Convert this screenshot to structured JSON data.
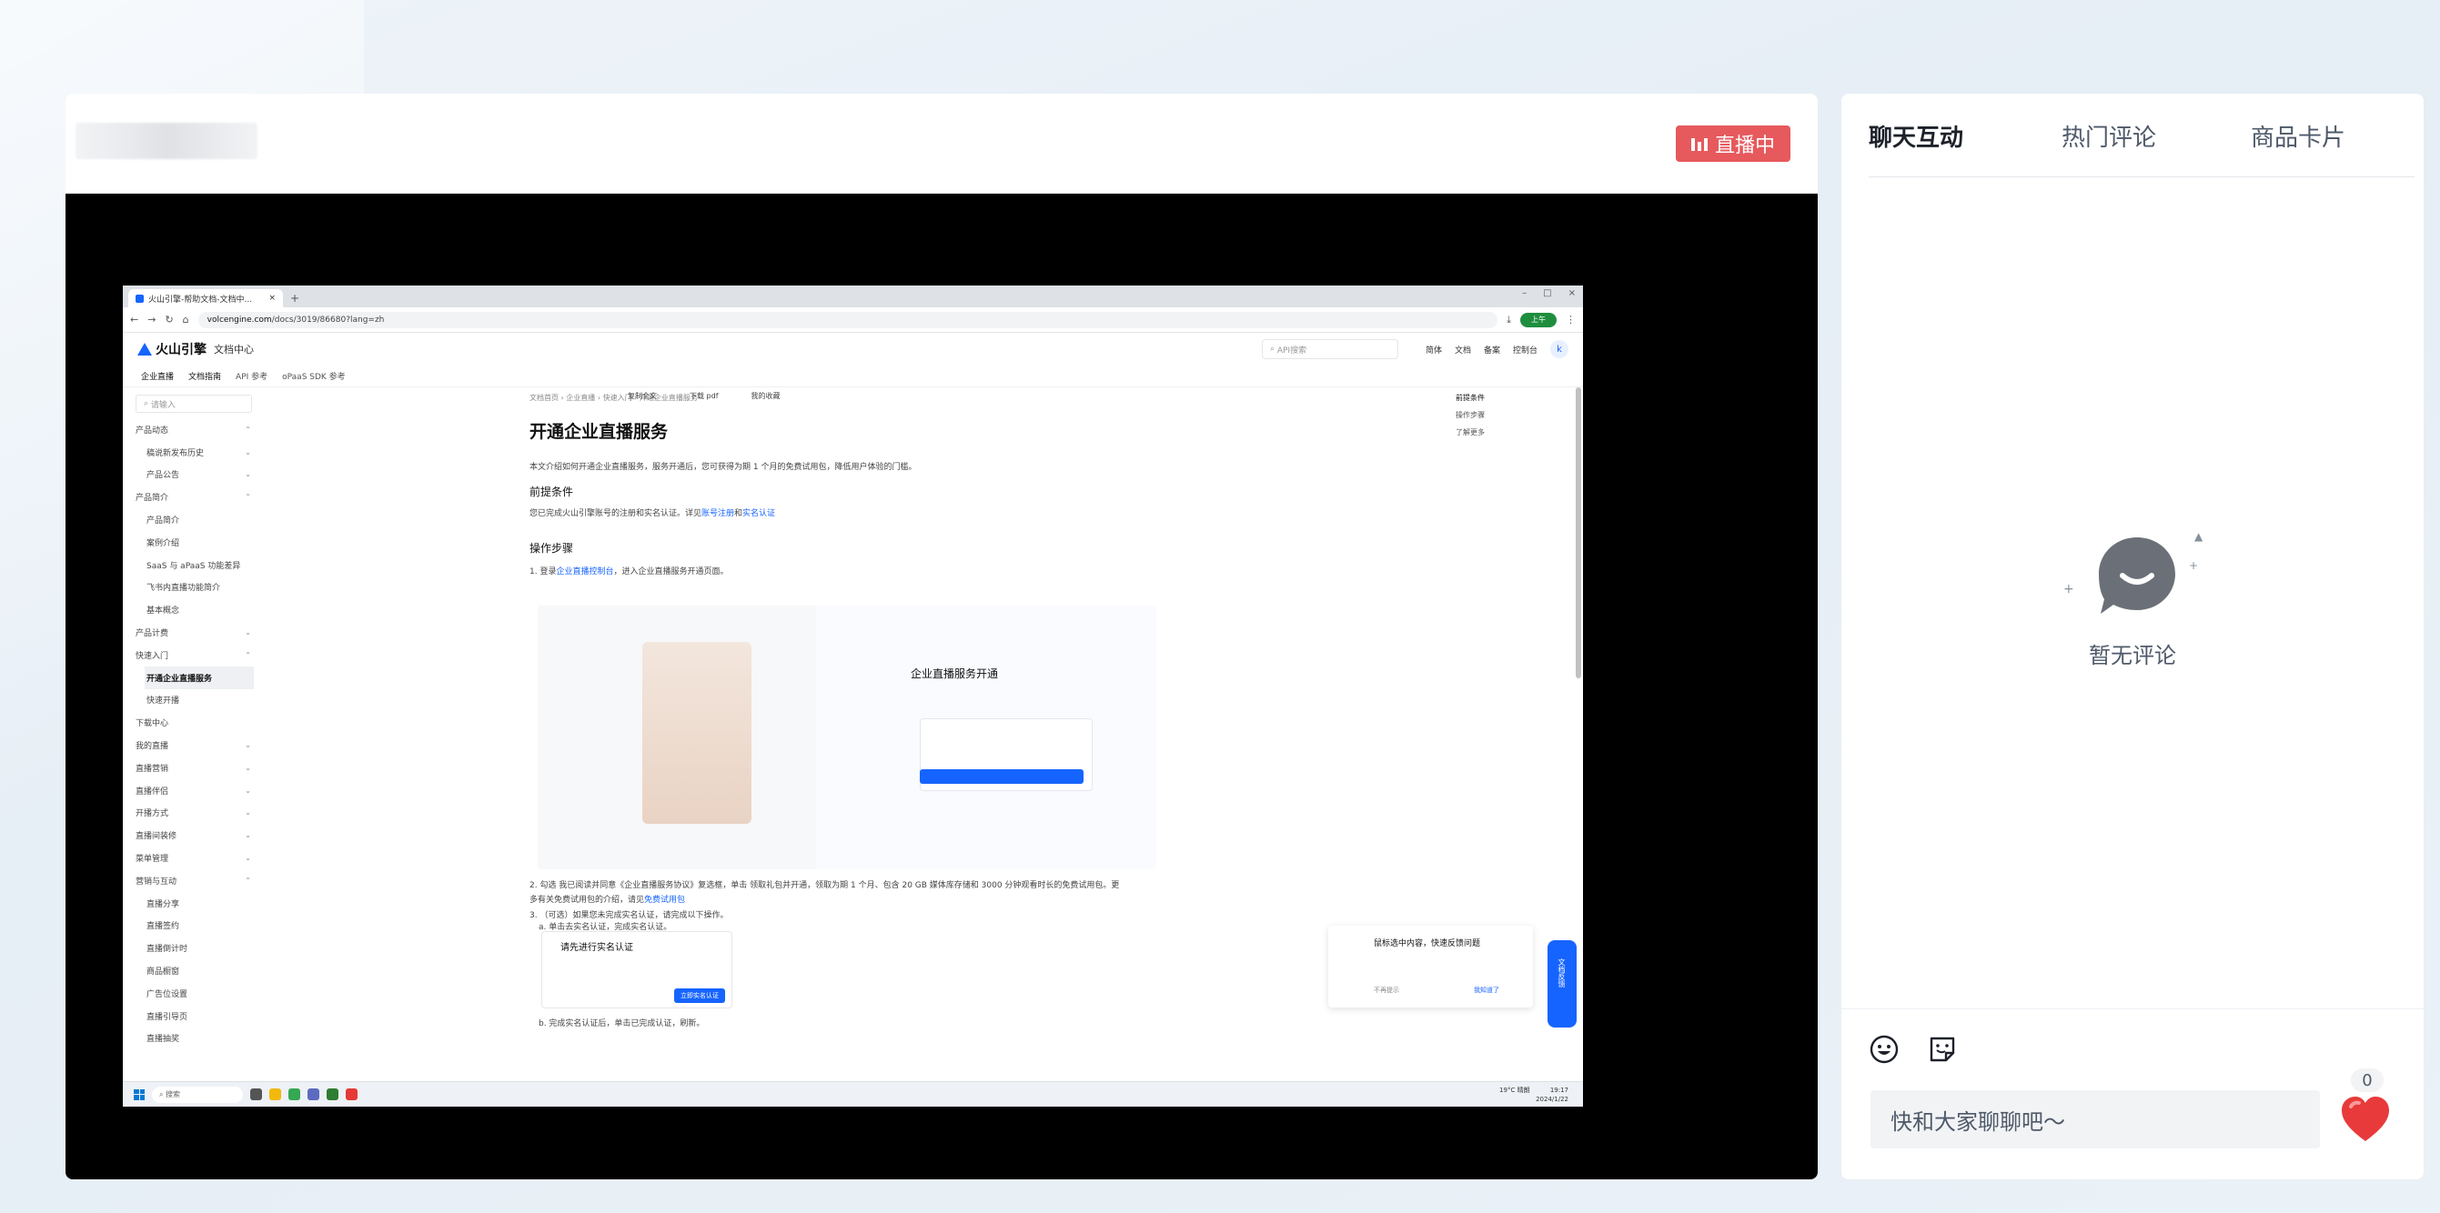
{
  "stream": {
    "live_label": "直播中"
  },
  "screen": {
    "tab_title": "火山引擎-帮助文档-文档中...",
    "url_host": "volcengine.com",
    "url_path": "/docs/3019/86680?lang=zh",
    "profile_label": "上午",
    "site_brand": "火山引擎",
    "site_section": "文档中心",
    "search_placeholder": "API搜索",
    "header_links": [
      "简体",
      "文档",
      "备案",
      "控制台"
    ],
    "avatar_letter": "k",
    "subnav": [
      "企业直播",
      "文档指南",
      "API 参考",
      "oPaaS SDK 参考"
    ],
    "nav_search_placeholder": "请输入",
    "nav_items": [
      {
        "label": "产品动态",
        "level": 1,
        "chev": "^"
      },
      {
        "label": "稿说新发布历史",
        "level": 2,
        "chev": "v"
      },
      {
        "label": "产品公告",
        "level": 2,
        "chev": "v"
      },
      {
        "label": "产品简介",
        "level": 1,
        "chev": "^"
      },
      {
        "label": "产品简介",
        "level": 2,
        "chev": ""
      },
      {
        "label": "案例介绍",
        "level": 2,
        "chev": ""
      },
      {
        "label": "SaaS 与 aPaaS 功能差异",
        "level": 2,
        "chev": ""
      },
      {
        "label": "飞书内直播功能简介",
        "level": 2,
        "chev": ""
      },
      {
        "label": "基本概念",
        "level": 2,
        "chev": ""
      },
      {
        "label": "产品计费",
        "level": 1,
        "chev": "v"
      },
      {
        "label": "快速入门",
        "level": 1,
        "chev": "^"
      },
      {
        "label": "开通企业直播服务",
        "level": 2,
        "chev": "",
        "active": true
      },
      {
        "label": "快速开播",
        "level": 2,
        "chev": ""
      },
      {
        "label": "下载中心",
        "level": 1,
        "chev": ""
      },
      {
        "label": "我的直播",
        "level": 1,
        "chev": "v"
      },
      {
        "label": "直播营销",
        "level": 1,
        "chev": "v"
      },
      {
        "label": "直播伴侣",
        "level": 1,
        "chev": "v"
      },
      {
        "label": "开播方式",
        "level": 1,
        "chev": "v"
      },
      {
        "label": "直播间装修",
        "level": 1,
        "chev": "v"
      },
      {
        "label": "菜单管理",
        "level": 1,
        "chev": "v"
      },
      {
        "label": "营销与互动",
        "level": 1,
        "chev": "^"
      },
      {
        "label": "直播分享",
        "level": 2,
        "chev": ""
      },
      {
        "label": "直播签约",
        "level": 2,
        "chev": ""
      },
      {
        "label": "直播倒计时",
        "level": 2,
        "chev": ""
      },
      {
        "label": "商品橱窗",
        "level": 2,
        "chev": ""
      },
      {
        "label": "广告位设置",
        "level": 2,
        "chev": ""
      },
      {
        "label": "直播引导页",
        "level": 2,
        "chev": ""
      },
      {
        "label": "直播抽奖",
        "level": 2,
        "chev": ""
      }
    ],
    "breadcrumb": "文档首页 › 企业直播 › 快速入门 › 开通企业直播服务",
    "doc_tools": [
      "复制全文",
      "下载 pdf",
      "我的收藏"
    ],
    "doc_title": "开通企业直播服务",
    "intro": "本文介绍如何开通企业直播服务，服务开通后，您可获得为期 1 个月的免费试用包，降低用户体验的门槛。",
    "prereq_heading": "前提条件",
    "prereq_text": "您已完成火山引擎账号的注册和实名认证。详见",
    "prereq_link1": "账号注册",
    "prereq_link_sep": "和",
    "prereq_link2": "实名认证",
    "steps_heading": "操作步骤",
    "step1_text": "1. 登录",
    "step1_link": "企业直播控制台",
    "step1_rest": "，进入企业直播服务开通页面。",
    "hero_title": "企业直播服务开通",
    "step2_text": "2. 勾选 我已阅读并同意《企业直播服务协议》复选框，单击 领取礼包并开通，领取为期 1 个月、包含 20 GB 媒体库存储和 3000 分钟观看时长的免费试用包。更",
    "step2_text2": "多有关免费试用包的介绍，请见",
    "step2_link": "免费试用包",
    "step3_text": "3. （可选）如果您未完成实名认证，请完成以下操作。",
    "step3a": "a. 单击去实名认证，完成实名认证。",
    "modal_title": "请先进行实名认证",
    "modal_btn": "立即实名认证",
    "step3b": "b. 完成实名认证后，单击已完成认证，刷新。",
    "toc": [
      "前提条件",
      "操作步骤",
      "了解更多"
    ],
    "float_title": "鼠标选中内容，快速反馈问题",
    "float_cancel": "不再提示",
    "float_ok": "我知道了",
    "feedback_label": "文档反馈",
    "taskbar_search": "搜索",
    "weather": "19°C 晴朗",
    "clock_time": "19:17",
    "clock_date": "2024/1/22"
  },
  "side": {
    "tabs": [
      "聊天互动",
      "热门评论",
      "商品卡片"
    ],
    "active_tab": 0,
    "empty_text": "暂无评论",
    "input_placeholder": "快和大家聊聊吧～",
    "like_count": "0",
    "icons": [
      "smile-emoji-icon",
      "sticker-icon",
      "heart-like-icon"
    ]
  },
  "colors": {
    "live_red": "#e6595d",
    "brand_blue": "#1664ff",
    "heart_red": "#e83a3a"
  }
}
